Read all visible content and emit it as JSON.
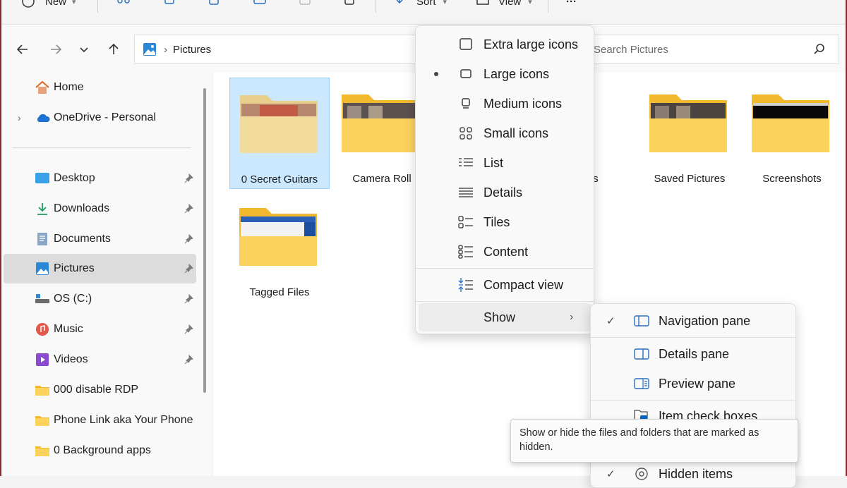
{
  "toolbar": {
    "new_label": "New",
    "sort_label": "Sort",
    "view_label": "View",
    "more_label": "···"
  },
  "address": {
    "crumb": "Pictures",
    "search_placeholder": "Search Pictures"
  },
  "sidebar": {
    "items": [
      {
        "label": "Home",
        "icon": "home-icon"
      },
      {
        "label": "OneDrive - Personal",
        "icon": "cloud-icon"
      },
      {
        "label": "Desktop",
        "icon": "desktop-icon"
      },
      {
        "label": "Downloads",
        "icon": "download-icon"
      },
      {
        "label": "Documents",
        "icon": "document-icon"
      },
      {
        "label": "Pictures",
        "icon": "pictures-icon"
      },
      {
        "label": "OS (C:)",
        "icon": "drive-icon"
      },
      {
        "label": "Music",
        "icon": "music-icon"
      },
      {
        "label": "Videos",
        "icon": "videos-icon"
      },
      {
        "label": "000 disable RDP",
        "icon": "folder-icon"
      },
      {
        "label": "Phone Link aka Your Phone",
        "icon": "folder-icon"
      },
      {
        "label": "0 Background apps",
        "icon": "folder-icon"
      }
    ]
  },
  "content": {
    "folders": [
      {
        "label": "0 Secret Guitars"
      },
      {
        "label": "Camera Roll"
      },
      {
        "label": "cons"
      },
      {
        "label": "Saved Pictures"
      },
      {
        "label": "Screenshots"
      },
      {
        "label": "Tagged Files"
      }
    ]
  },
  "view_menu": {
    "items": [
      {
        "label": "Extra large icons",
        "icon": "extra-large-icons-icon"
      },
      {
        "label": "Large icons",
        "icon": "large-icons-icon"
      },
      {
        "label": "Medium icons",
        "icon": "medium-icons-icon"
      },
      {
        "label": "Small icons",
        "icon": "small-icons-icon"
      },
      {
        "label": "List",
        "icon": "list-icon"
      },
      {
        "label": "Details",
        "icon": "details-icon"
      },
      {
        "label": "Tiles",
        "icon": "tiles-icon"
      },
      {
        "label": "Content",
        "icon": "content-icon"
      },
      {
        "label": "Compact view",
        "icon": "compact-view-icon"
      },
      {
        "label": "Show",
        "icon": "chevron-right-icon"
      }
    ]
  },
  "show_menu": {
    "items": [
      {
        "label": "Navigation pane",
        "checked": true
      },
      {
        "label": "Details pane",
        "checked": false
      },
      {
        "label": "Preview pane",
        "checked": false
      },
      {
        "label": "Item check boxes",
        "checked": false
      },
      {
        "label": "Hidden items",
        "checked": true
      }
    ]
  },
  "tooltip": {
    "text": "Show or hide the files and folders that are marked as hidden."
  },
  "colors": {
    "selection": "#cce8ff",
    "folder": "#f8c94a",
    "accent": "#0067c0"
  }
}
